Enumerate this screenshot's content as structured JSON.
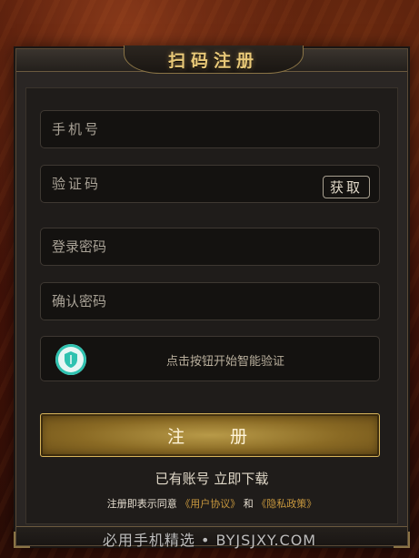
{
  "header": {
    "title": "扫码注册"
  },
  "form": {
    "phone": {
      "placeholder": "手机号"
    },
    "code": {
      "placeholder": "验证码",
      "get_label": "获取"
    },
    "password": {
      "placeholder": "登录密码"
    },
    "confirm": {
      "placeholder": "确认密码"
    },
    "captcha": {
      "label": "点击按钮开始智能验证",
      "icon": "shield-icon"
    },
    "register_label": "注 册"
  },
  "footer": {
    "login_link": "已有账号 立即下载",
    "terms_prefix": "注册即表示同意",
    "user_agreement": "《用户协议》",
    "and": "和",
    "privacy_policy": "《隐私政策》"
  },
  "watermark": "必用手机精选 • BYJSJXY.COM",
  "colors": {
    "accent_gold": "#c8983e",
    "button_gold": "#8a6a24",
    "shield_teal": "#2fc2b0"
  }
}
